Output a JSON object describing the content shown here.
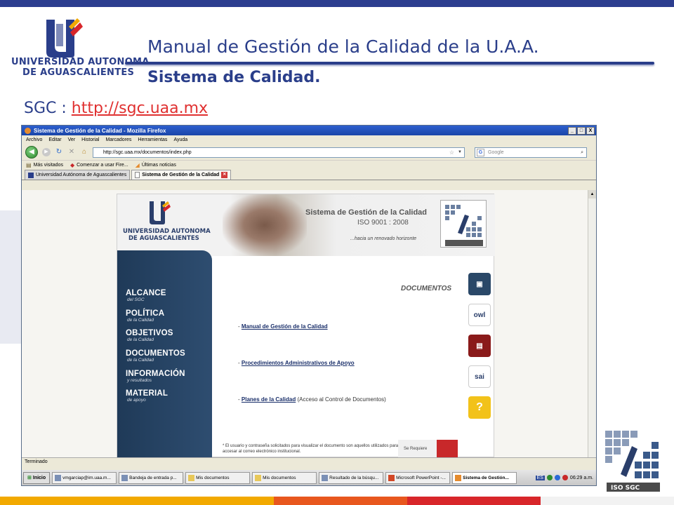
{
  "slide": {
    "title": "Manual de Gestión de la Calidad de la U.A.A.",
    "subtitle": "Sistema de Calidad.",
    "sgc_prefix": "SGC : ",
    "sgc_link": "http://sgc.uaa.mx",
    "logo_line1": "UNIVERSIDAD AUTONOMA",
    "logo_line2": "DE AGUASCALIENTES",
    "iso_logo_text": "ISO SGC",
    "colors": {
      "navy": "#2a3e8a",
      "top_bar": "#2d3e8f",
      "link_red": "#e03131",
      "bottom_bar": [
        "#f2a900",
        "#e8571e",
        "#d8262a",
        "#f2f2f2"
      ]
    }
  },
  "browser": {
    "window_title": "Sistema de Gestión de la Calidad - Mozilla Firefox",
    "window_buttons": [
      "_",
      "□",
      "X"
    ],
    "menu": [
      "Archivo",
      "Editar",
      "Ver",
      "Historial",
      "Marcadores",
      "Herramientas",
      "Ayuda"
    ],
    "url": "http://sgc.uaa.mx/documentos/index.php",
    "search_placeholder": "Google",
    "bookmarks": [
      "Más visitados",
      "Comenzar a usar Fire...",
      "Últimas noticias"
    ],
    "tabs": [
      {
        "label": "Universidad Autónoma de Aguascalientes",
        "active": false
      },
      {
        "label": "Sistema de Gestión de la Calidad",
        "active": true
      }
    ],
    "status": "Terminado"
  },
  "site": {
    "logo_line1": "UNIVERSIDAD AUTONOMA",
    "logo_line2": "DE AGUASCALIENTES",
    "header_title": "Sistema de Gestión de la Calidad",
    "header_iso": "ISO 9001 : 2008",
    "header_tagline": "...hacia un renovado horizonte",
    "header_badge": "ISO SGC",
    "nav": [
      {
        "label": "ALCANCE",
        "sub": "del SGC"
      },
      {
        "label": "POLÍTICA",
        "sub": "de la Calidad"
      },
      {
        "label": "OBJETIVOS",
        "sub": "de la Calidad"
      },
      {
        "label": "DOCUMENTOS",
        "sub": "de la Calidad"
      },
      {
        "label": "INFORMACIÓN",
        "sub": "y resultados"
      },
      {
        "label": "MATERIAL",
        "sub": "de apoyo"
      }
    ],
    "documents_heading": "DOCUMENTOS",
    "doc_links": [
      {
        "prefix": "- ",
        "link": "Manual de Gestión de la Calidad",
        "suffix": ""
      },
      {
        "prefix": "- ",
        "link": "Procedimientos Administrativos de Apoyo",
        "suffix": ""
      },
      {
        "prefix": "- ",
        "link": "Planes de la Calidad",
        "suffix": " (Acceso al Control de Documentos)"
      }
    ],
    "side_icons": [
      {
        "name": "documents-icon",
        "label": "",
        "color": "#2a4868",
        "fg": "#ffffff"
      },
      {
        "name": "owl-icon",
        "label": "owl",
        "color": "#ffffff",
        "fg": "#2a3e6a"
      },
      {
        "name": "file-icon",
        "label": "",
        "color": "#8a1a1a",
        "fg": "#ffffff"
      },
      {
        "name": "sai-icon",
        "label": "sai",
        "color": "#ffffff",
        "fg": "#2a3e6a"
      },
      {
        "name": "help-icon",
        "label": "?",
        "color": "#f2c21a",
        "fg": "#ffffff"
      }
    ],
    "footer_note": "* El usuario y contraseña solicitados para visualizar el documento son aquellos utilizados para accesar al correo electrónico institucional.",
    "footer_badge_text": "Se Requiere"
  },
  "taskbar": {
    "start": "Inicio",
    "items": [
      {
        "label": "vmgarciap@im.uaa.m...",
        "active": false
      },
      {
        "label": "Bandeja de entrada p...",
        "active": false
      },
      {
        "label": "Mis documentos",
        "active": false
      },
      {
        "label": "Mis documentos",
        "active": false
      },
      {
        "label": "Resultado de la búsqu...",
        "active": false
      },
      {
        "label": "Microsoft PowerPoint -...",
        "active": false
      },
      {
        "label": "Sistema de Gestión...",
        "active": true
      }
    ],
    "lang": "ES",
    "clock": "06:29 a.m."
  }
}
